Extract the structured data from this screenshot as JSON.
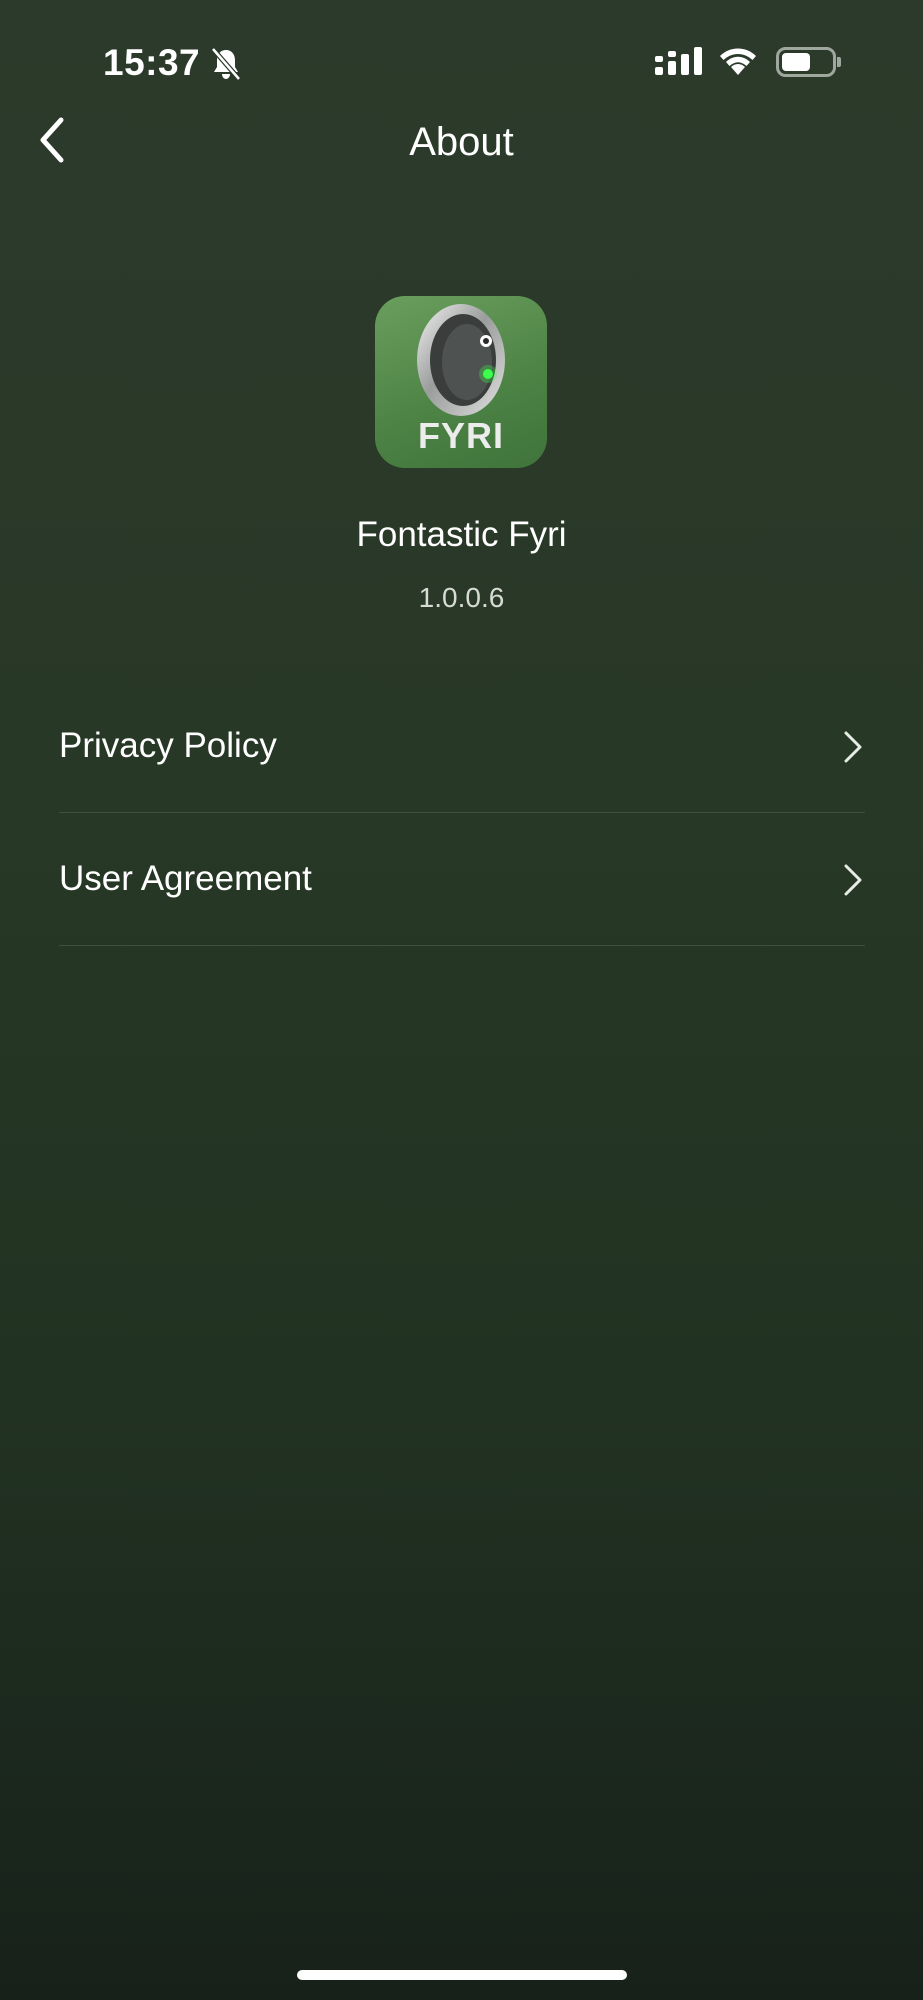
{
  "status_bar": {
    "time": "15:37",
    "icons": [
      "bell-slash-icon",
      "cellular-signal-icon",
      "wifi-icon",
      "battery-icon"
    ]
  },
  "nav": {
    "back_icon": "chevron-left-icon",
    "title": "About"
  },
  "app": {
    "icon_text": "FYRI",
    "name": "Fontastic Fyri",
    "version": "1.0.0.6"
  },
  "menu": {
    "items": [
      {
        "label": "Privacy Policy",
        "icon": "chevron-right-icon"
      },
      {
        "label": "User Agreement",
        "icon": "chevron-right-icon"
      }
    ]
  },
  "colors": {
    "background_top": "#2c3a2b",
    "background_bottom": "#17211a",
    "icon_green": "#4e8446",
    "text": "#ffffff",
    "secondary_text": "#d6dbd4"
  }
}
